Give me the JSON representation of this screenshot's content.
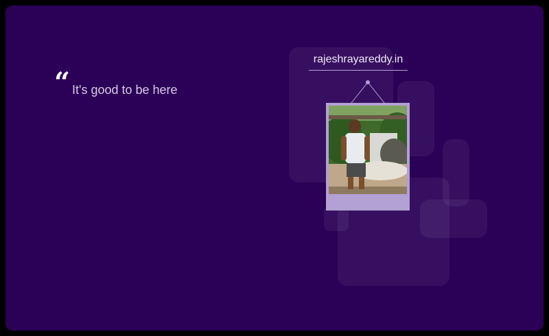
{
  "quote": {
    "mark": "“",
    "text": "It's good to be here"
  },
  "site": {
    "link_text": "rajeshrayareddy.in"
  },
  "photo": {
    "alt": "person standing near a waterfall"
  },
  "colors": {
    "background": "#2b0057",
    "frame": "#b3a0d4",
    "text": "#d9cbe8"
  }
}
